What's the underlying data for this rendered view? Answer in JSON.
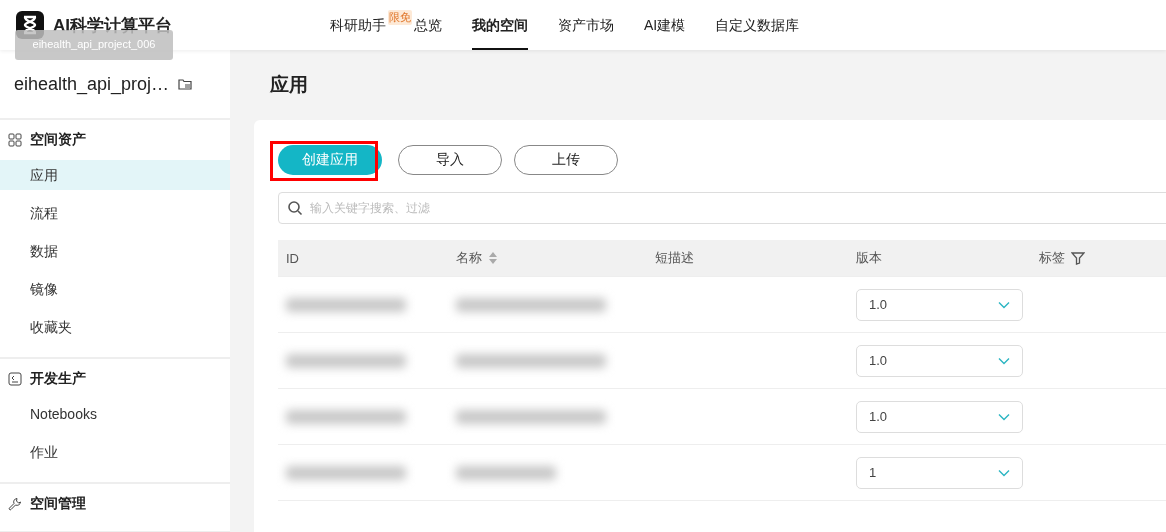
{
  "header": {
    "app_name": "AI科学计算平台",
    "tooltip": "eihealth_api_project_006",
    "nav": [
      {
        "label": "科研助手",
        "badge": "限免",
        "selected": false
      },
      {
        "label": "总览",
        "selected": false
      },
      {
        "label": "我的空间",
        "selected": true
      },
      {
        "label": "资产市场",
        "selected": false
      },
      {
        "label": "AI建模",
        "selected": false
      },
      {
        "label": "自定义数据库",
        "selected": false
      }
    ]
  },
  "sidebar": {
    "project": "eihealth_api_proj…",
    "groups": [
      {
        "kind": "assets",
        "title": "空间资产",
        "items": [
          {
            "label": "应用",
            "selected": true
          },
          {
            "label": "流程",
            "selected": false
          },
          {
            "label": "数据",
            "selected": false
          },
          {
            "label": "镜像",
            "selected": false
          },
          {
            "label": "收藏夹",
            "selected": false
          }
        ]
      },
      {
        "kind": "dev",
        "title": "开发生产",
        "items": [
          {
            "label": "Notebooks",
            "selected": false
          },
          {
            "label": "作业",
            "selected": false
          }
        ]
      },
      {
        "kind": "manage",
        "title": "空间管理"
      }
    ]
  },
  "page": {
    "title": "应用",
    "buttons": [
      {
        "label": "创建应用",
        "kind": "primary",
        "highlighted": true
      },
      {
        "label": "导入",
        "kind": "outline",
        "highlighted": false
      },
      {
        "label": "上传",
        "kind": "outline",
        "highlighted": false
      }
    ],
    "search": {
      "placeholder": "输入关键字搜索、过滤"
    },
    "table": {
      "columns": [
        {
          "label": "ID",
          "kind": "plain"
        },
        {
          "label": "名称",
          "kind": "sort"
        },
        {
          "label": "短描述",
          "kind": "plain"
        },
        {
          "label": "版本",
          "kind": "plain"
        },
        {
          "label": "标签",
          "kind": "filter"
        }
      ],
      "rows": [
        {
          "version": "1.0"
        },
        {
          "version": "1.0"
        },
        {
          "version": "1.0"
        },
        {
          "version": "1"
        }
      ]
    }
  }
}
